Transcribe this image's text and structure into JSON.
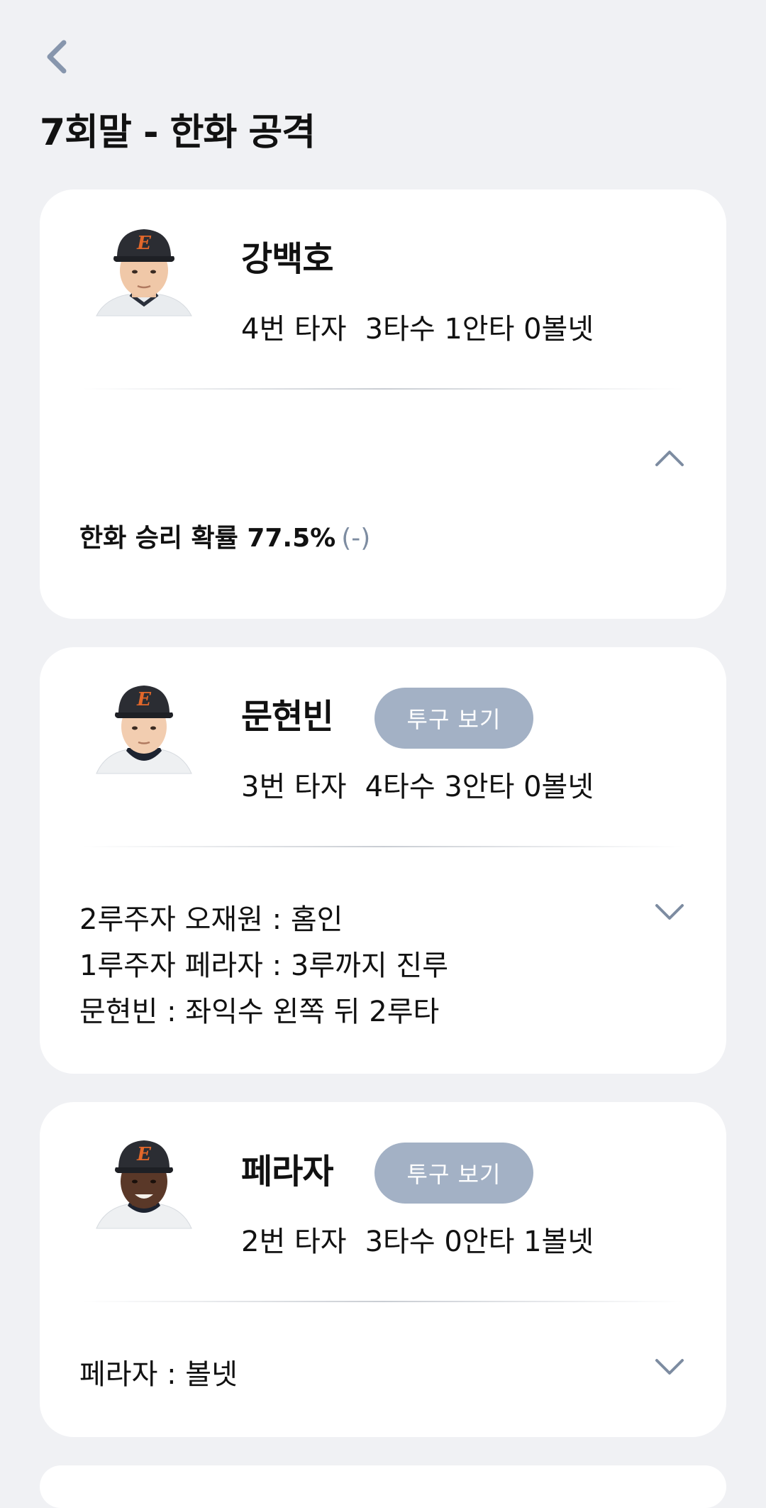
{
  "header": {
    "title": "7회말 - 한화 공격"
  },
  "colors": {
    "background": "#f0f1f4",
    "card": "#ffffff",
    "pitch_button": "#a3b1c5",
    "delta_text": "#7d8ca1",
    "cap_logo": "#e2672a"
  },
  "cards": [
    {
      "player": "강백호",
      "order": "4번 타자",
      "stats": "3타수 1안타 0볼넷",
      "win_prob_label": "한화 승리 확률 77.5%",
      "win_prob_delta": "(-)",
      "expanded": true
    },
    {
      "player": "문현빈",
      "pitch_button": "투구 보기",
      "order": "3번 타자",
      "stats": "4타수 3안타 0볼넷",
      "events": [
        "2루주자 오재원 : 홈인",
        "1루주자 페라자 : 3루까지 진루",
        "문현빈 : 좌익수 왼쪽 뒤 2루타"
      ],
      "expanded": false
    },
    {
      "player": "페라자",
      "pitch_button": "투구 보기",
      "order": "2번 타자",
      "stats": "3타수 0안타 1볼넷",
      "events": [
        "페라자 : 볼넷"
      ],
      "expanded": false
    }
  ]
}
